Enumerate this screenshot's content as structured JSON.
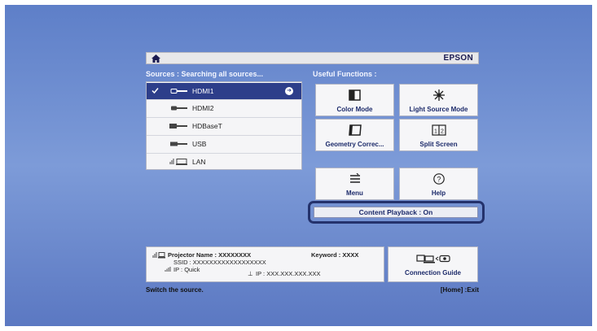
{
  "colors": {
    "screen": "#6c8bd0",
    "selected": "#2d3e8a",
    "panel": "#f5f5f7",
    "highlight": "#24326c"
  },
  "header": {
    "home_icon": "home-icon",
    "brand": "EPSON"
  },
  "sources": {
    "title": "Sources : Searching all sources...",
    "items": [
      {
        "label": "HDMI1",
        "icon": "hdmi-cable-icon",
        "selected": true
      },
      {
        "label": "HDMI2",
        "icon": "hdmi-cable-icon",
        "selected": false
      },
      {
        "label": "HDBaseT",
        "icon": "hdbaset-cable-icon",
        "selected": false
      },
      {
        "label": "USB",
        "icon": "usb-cable-icon",
        "selected": false
      },
      {
        "label": "LAN",
        "icon": "lan-icon",
        "selected": false
      }
    ]
  },
  "functions": {
    "title": "Useful Functions :",
    "tiles": [
      {
        "label": "Color Mode",
        "icon": "color-mode-icon"
      },
      {
        "label": "Light Source Mode",
        "icon": "light-source-icon"
      },
      {
        "label": "Geometry Correc...",
        "icon": "geometry-correction-icon"
      },
      {
        "label": "Split Screen",
        "icon": "split-screen-icon"
      },
      {
        "label": "Menu",
        "icon": "menu-icon"
      },
      {
        "label": "Help",
        "icon": "help-icon"
      }
    ],
    "content_playback": "Content Playback : On"
  },
  "info": {
    "projector_name": "Projector Name : XXXXXXXX",
    "keyword": "Keyword : XXXX",
    "ssid": "SSID : XXXXXXXXXXXXXXXXXX",
    "ip_mode": "IP : Quick",
    "ip_addr": "IP : XXX.XXX.XXX.XXX"
  },
  "connection_guide": {
    "label": "Connection Guide",
    "icon": "connection-guide-icon"
  },
  "footer": {
    "hint": "Switch the source.",
    "exit": "[Home] :Exit"
  }
}
